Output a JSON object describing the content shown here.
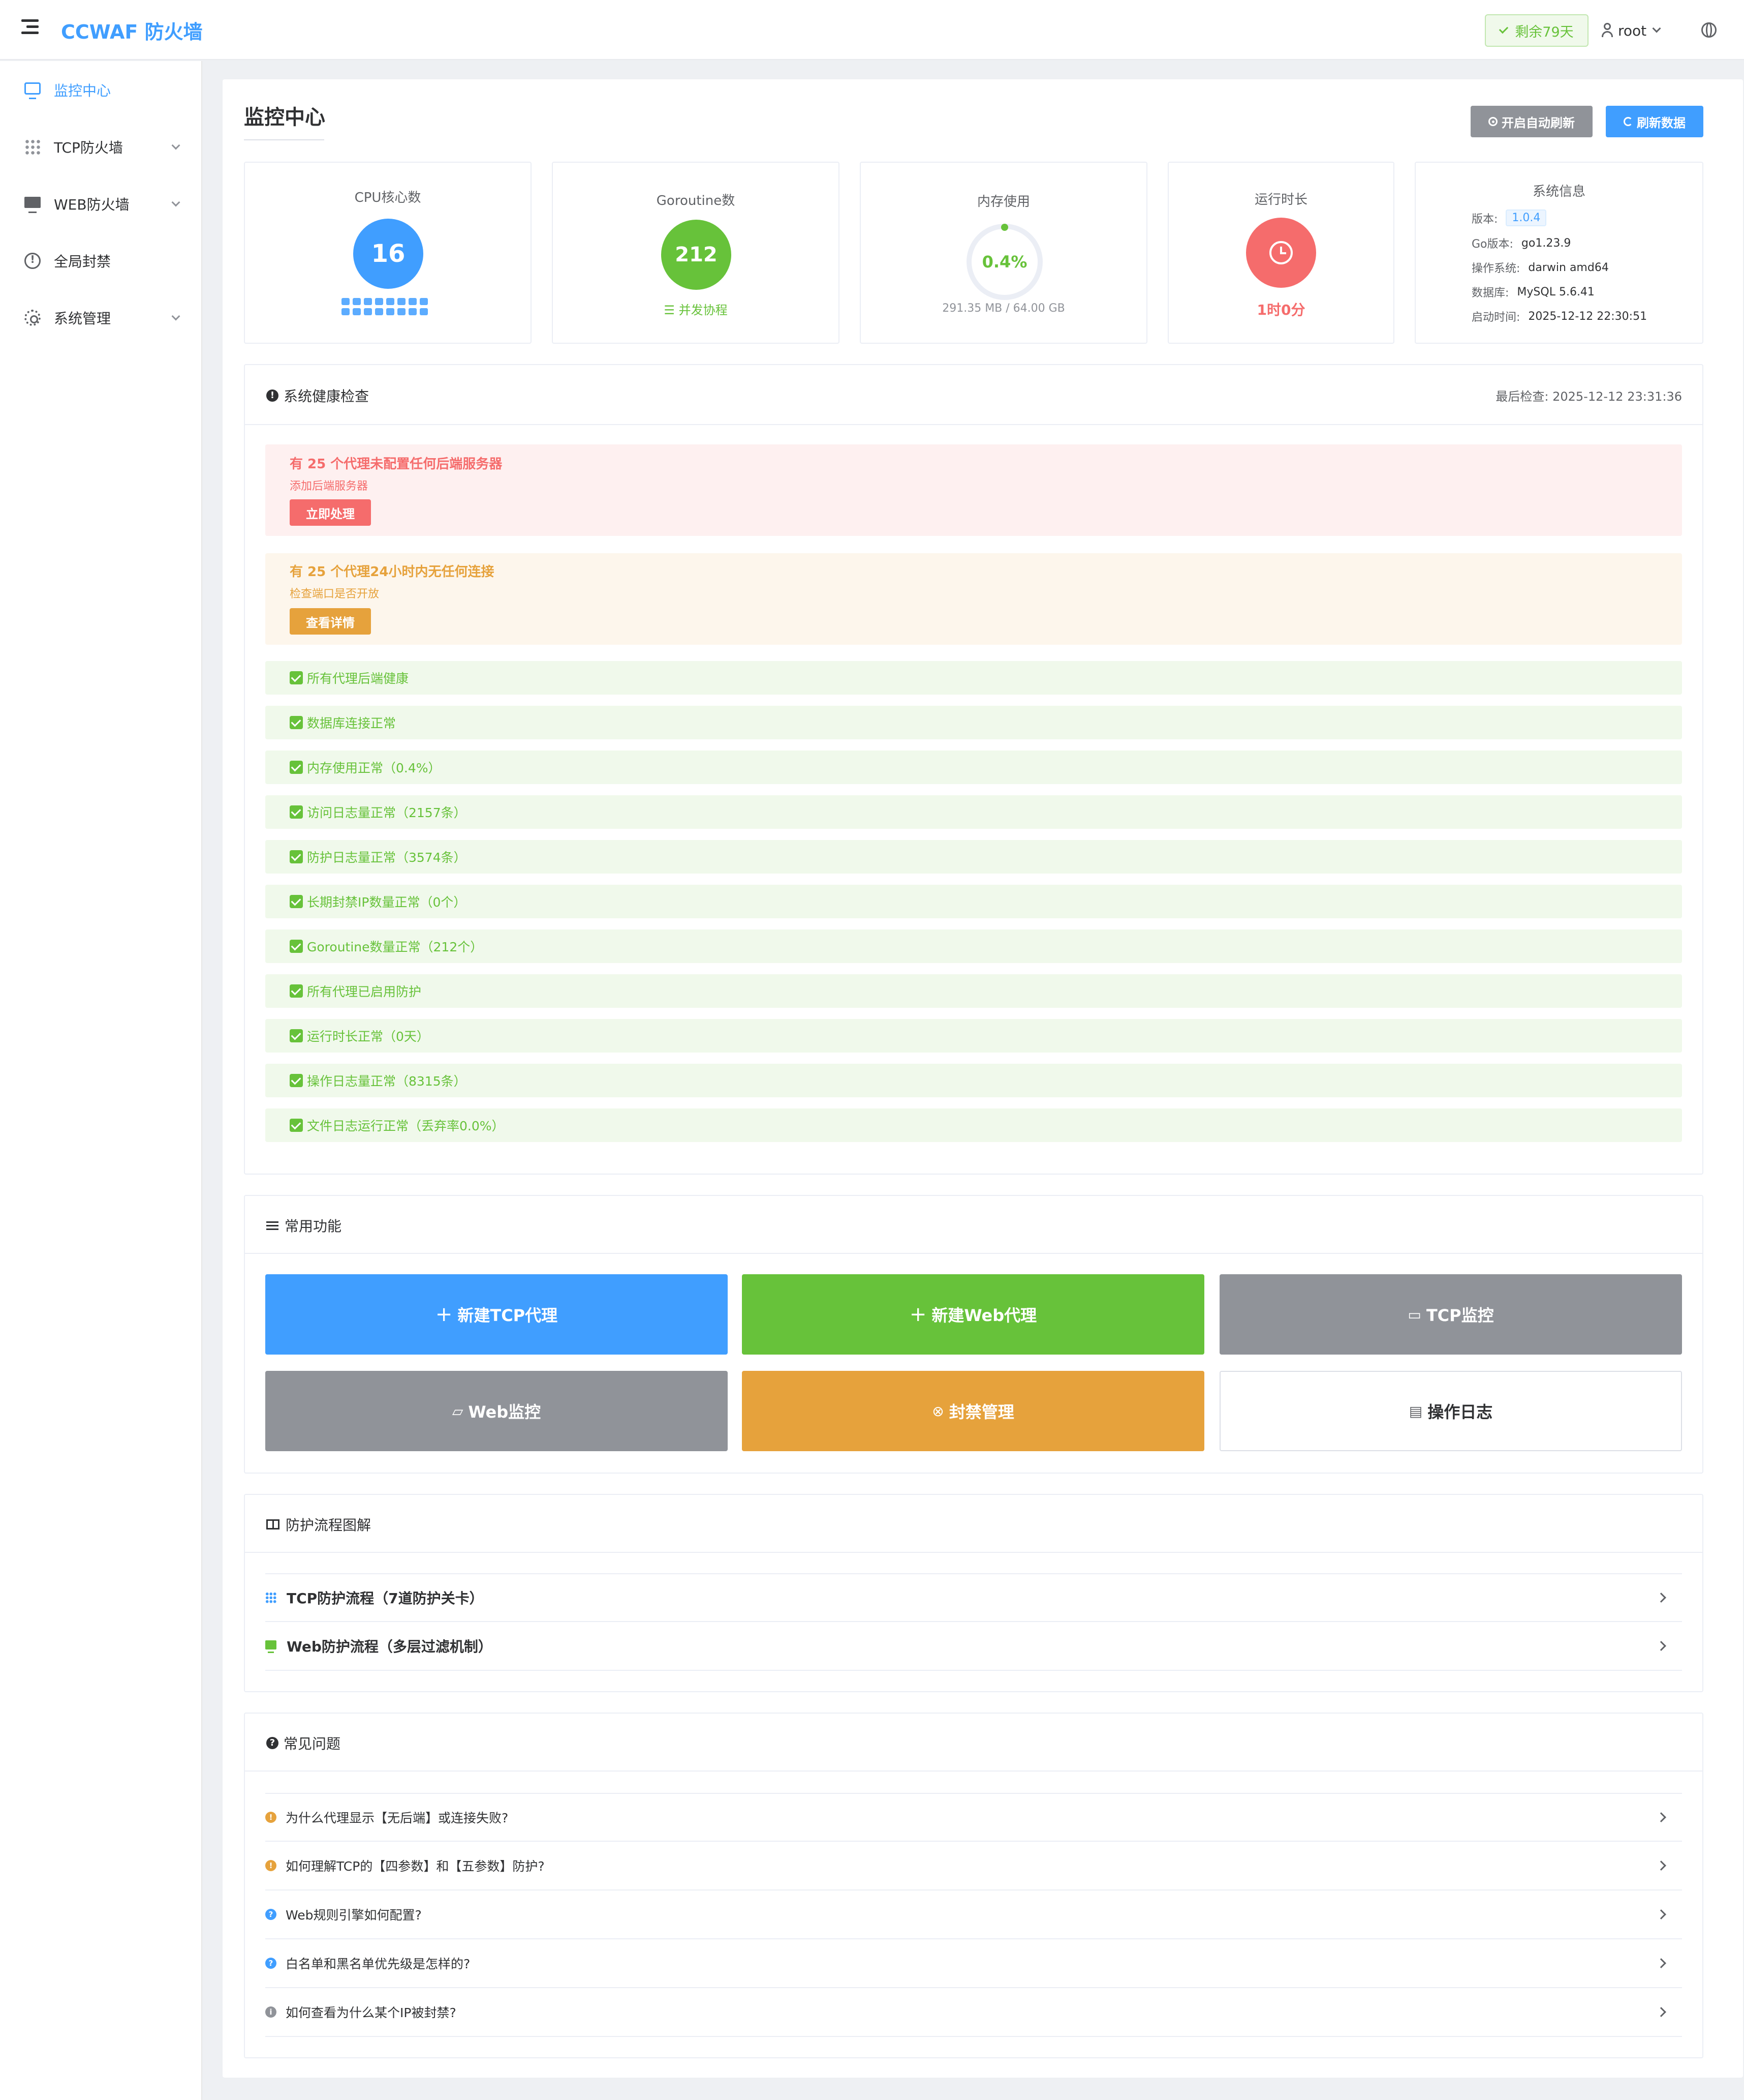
{
  "app": {
    "brand": "CCWAF 防火墙"
  },
  "header": {
    "license": "剩余79天",
    "user": "root"
  },
  "sidebar": {
    "items": [
      {
        "label": "监控中心",
        "active": true,
        "icon": "monitor-icon"
      },
      {
        "label": "TCP防火墙",
        "icon": "grid-icon",
        "expandable": true
      },
      {
        "label": "WEB防火墙",
        "icon": "screen-icon",
        "expandable": true
      },
      {
        "label": "全局封禁",
        "icon": "warning-icon"
      },
      {
        "label": "系统管理",
        "icon": "gear-icon",
        "expandable": true
      }
    ]
  },
  "page": {
    "title": "监控中心",
    "auto_refresh": "开启自动刷新",
    "refresh": "刷新数据"
  },
  "stats": {
    "cpu": {
      "label": "CPU核心数",
      "value": "16"
    },
    "goroutine": {
      "label": "Goroutine数",
      "value": "212",
      "sub": "并发协程"
    },
    "memory": {
      "label": "内存使用",
      "value": "0.4%",
      "percent": 0.4,
      "sub": "291.35 MB / 64.00 GB"
    },
    "uptime": {
      "label": "运行时长",
      "value": "1时0分"
    },
    "sysinfo": {
      "label": "系统信息",
      "version_k": "版本:",
      "version_v": "1.0.4",
      "go_k": "Go版本:",
      "go_v": "go1.23.9",
      "os_k": "操作系统:",
      "os_v": "darwin amd64",
      "db_k": "数据库:",
      "db_v": "MySQL 5.6.41",
      "start_k": "启动时间:",
      "start_v": "2025-12-12 22:30:51"
    }
  },
  "health": {
    "title": "系统健康检查",
    "last_check": "最后检查: 2025-12-12 23:31:36",
    "alerts": [
      {
        "title": "有 25 个代理未配置任何后端服务器",
        "desc": "添加后端服务器",
        "button": "立即处理",
        "level": "error"
      },
      {
        "title": "有 25 个代理24小时内无任何连接",
        "desc": "检查端口是否开放",
        "button": "查看详情",
        "level": "warning"
      }
    ],
    "ok": [
      "所有代理后端健康",
      "数据库连接正常",
      "内存使用正常（0.4%）",
      "访问日志量正常（2157条）",
      "防护日志量正常（3574条）",
      "长期封禁IP数量正常（0个）",
      "Goroutine数量正常（212个）",
      "所有代理已启用防护",
      "运行时长正常（0天）",
      "操作日志量正常（8315条）",
      "文件日志运行正常（丢弃率0.0%）"
    ]
  },
  "functions": {
    "title": "常用功能",
    "buttons": [
      {
        "label": "新建TCP代理",
        "color": "#409eff",
        "icon": "plus-icon"
      },
      {
        "label": "新建Web代理",
        "color": "#67c23a",
        "icon": "plus-icon"
      },
      {
        "label": "TCP监控",
        "color": "#909399",
        "icon": "monitor-icon"
      },
      {
        "label": "Web监控",
        "color": "#909399",
        "icon": "chat-icon"
      },
      {
        "label": "封禁管理",
        "color": "#e6a23c",
        "icon": "circle-x-icon"
      },
      {
        "label": "操作日志",
        "color": "#ffffff",
        "icon": "document-icon"
      }
    ]
  },
  "flow": {
    "title": "防护流程图解",
    "items": [
      {
        "label": "TCP防护流程（7道防护关卡）",
        "icon": "grid-icon"
      },
      {
        "label": "Web防护流程（多层过滤机制）",
        "icon": "screen-icon"
      }
    ]
  },
  "faq": {
    "title": "常见问题",
    "items": [
      {
        "q": "为什么代理显示【无后端】或连接失败?",
        "color": "#e6a23c"
      },
      {
        "q": "如何理解TCP的【四参数】和【五参数】防护?",
        "color": "#e6a23c"
      },
      {
        "q": "Web规则引擎如何配置?",
        "color": "#409eff"
      },
      {
        "q": "白名单和黑名单优先级是怎样的?",
        "color": "#409eff"
      },
      {
        "q": "如何查看为什么某个IP被封禁?",
        "color": "#909399"
      }
    ]
  }
}
